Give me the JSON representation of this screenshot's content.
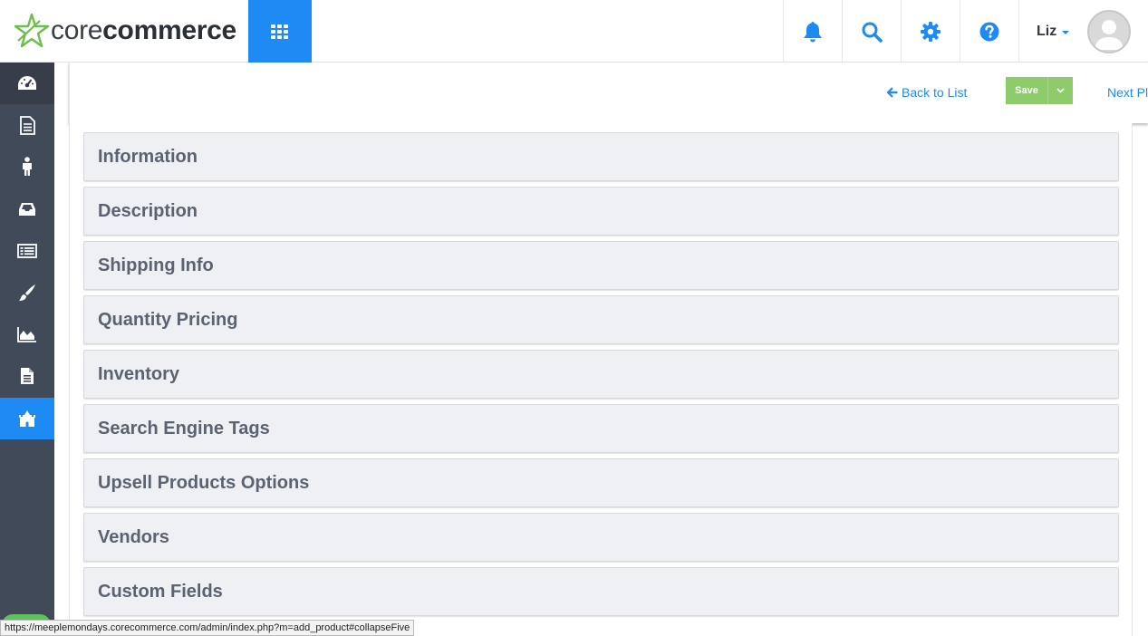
{
  "header": {
    "logo": {
      "text_light": "core",
      "text_bold": "commerce"
    },
    "icons": {
      "apps": "grid-icon",
      "notifications": "bell-icon",
      "search": "search-icon",
      "settings": "gear-icon",
      "help": "question-icon"
    },
    "user": {
      "name": "Liz"
    }
  },
  "sidebar": {
    "items": [
      {
        "icon": "dashboard-icon"
      },
      {
        "icon": "document-icon"
      },
      {
        "icon": "person-icon"
      },
      {
        "icon": "inbox-icon"
      },
      {
        "icon": "list-icon"
      },
      {
        "icon": "brush-icon"
      },
      {
        "icon": "chart-area-icon"
      },
      {
        "icon": "file-text-icon"
      },
      {
        "icon": "castle-icon",
        "active": true
      }
    ]
  },
  "toolbar": {
    "back_label": "Back to List",
    "save_label": "Save",
    "next_label": "Next Pl"
  },
  "panels": [
    "Information",
    "Description",
    "Shipping Info",
    "Quantity Pricing",
    "Inventory",
    "Search Engine Tags",
    "Upsell Products Options",
    "Vendors",
    "Custom Fields"
  ],
  "status_bar": {
    "url": "https://meeplemondays.corecommerce.com/admin/index.php?m=add_product#collapseFive"
  },
  "colors": {
    "accent": "#1e8bf5",
    "sidebar": "#414a58",
    "save": "#8ecb6a",
    "panel_bg": "#eef0f4",
    "panel_text": "#5b6270"
  }
}
